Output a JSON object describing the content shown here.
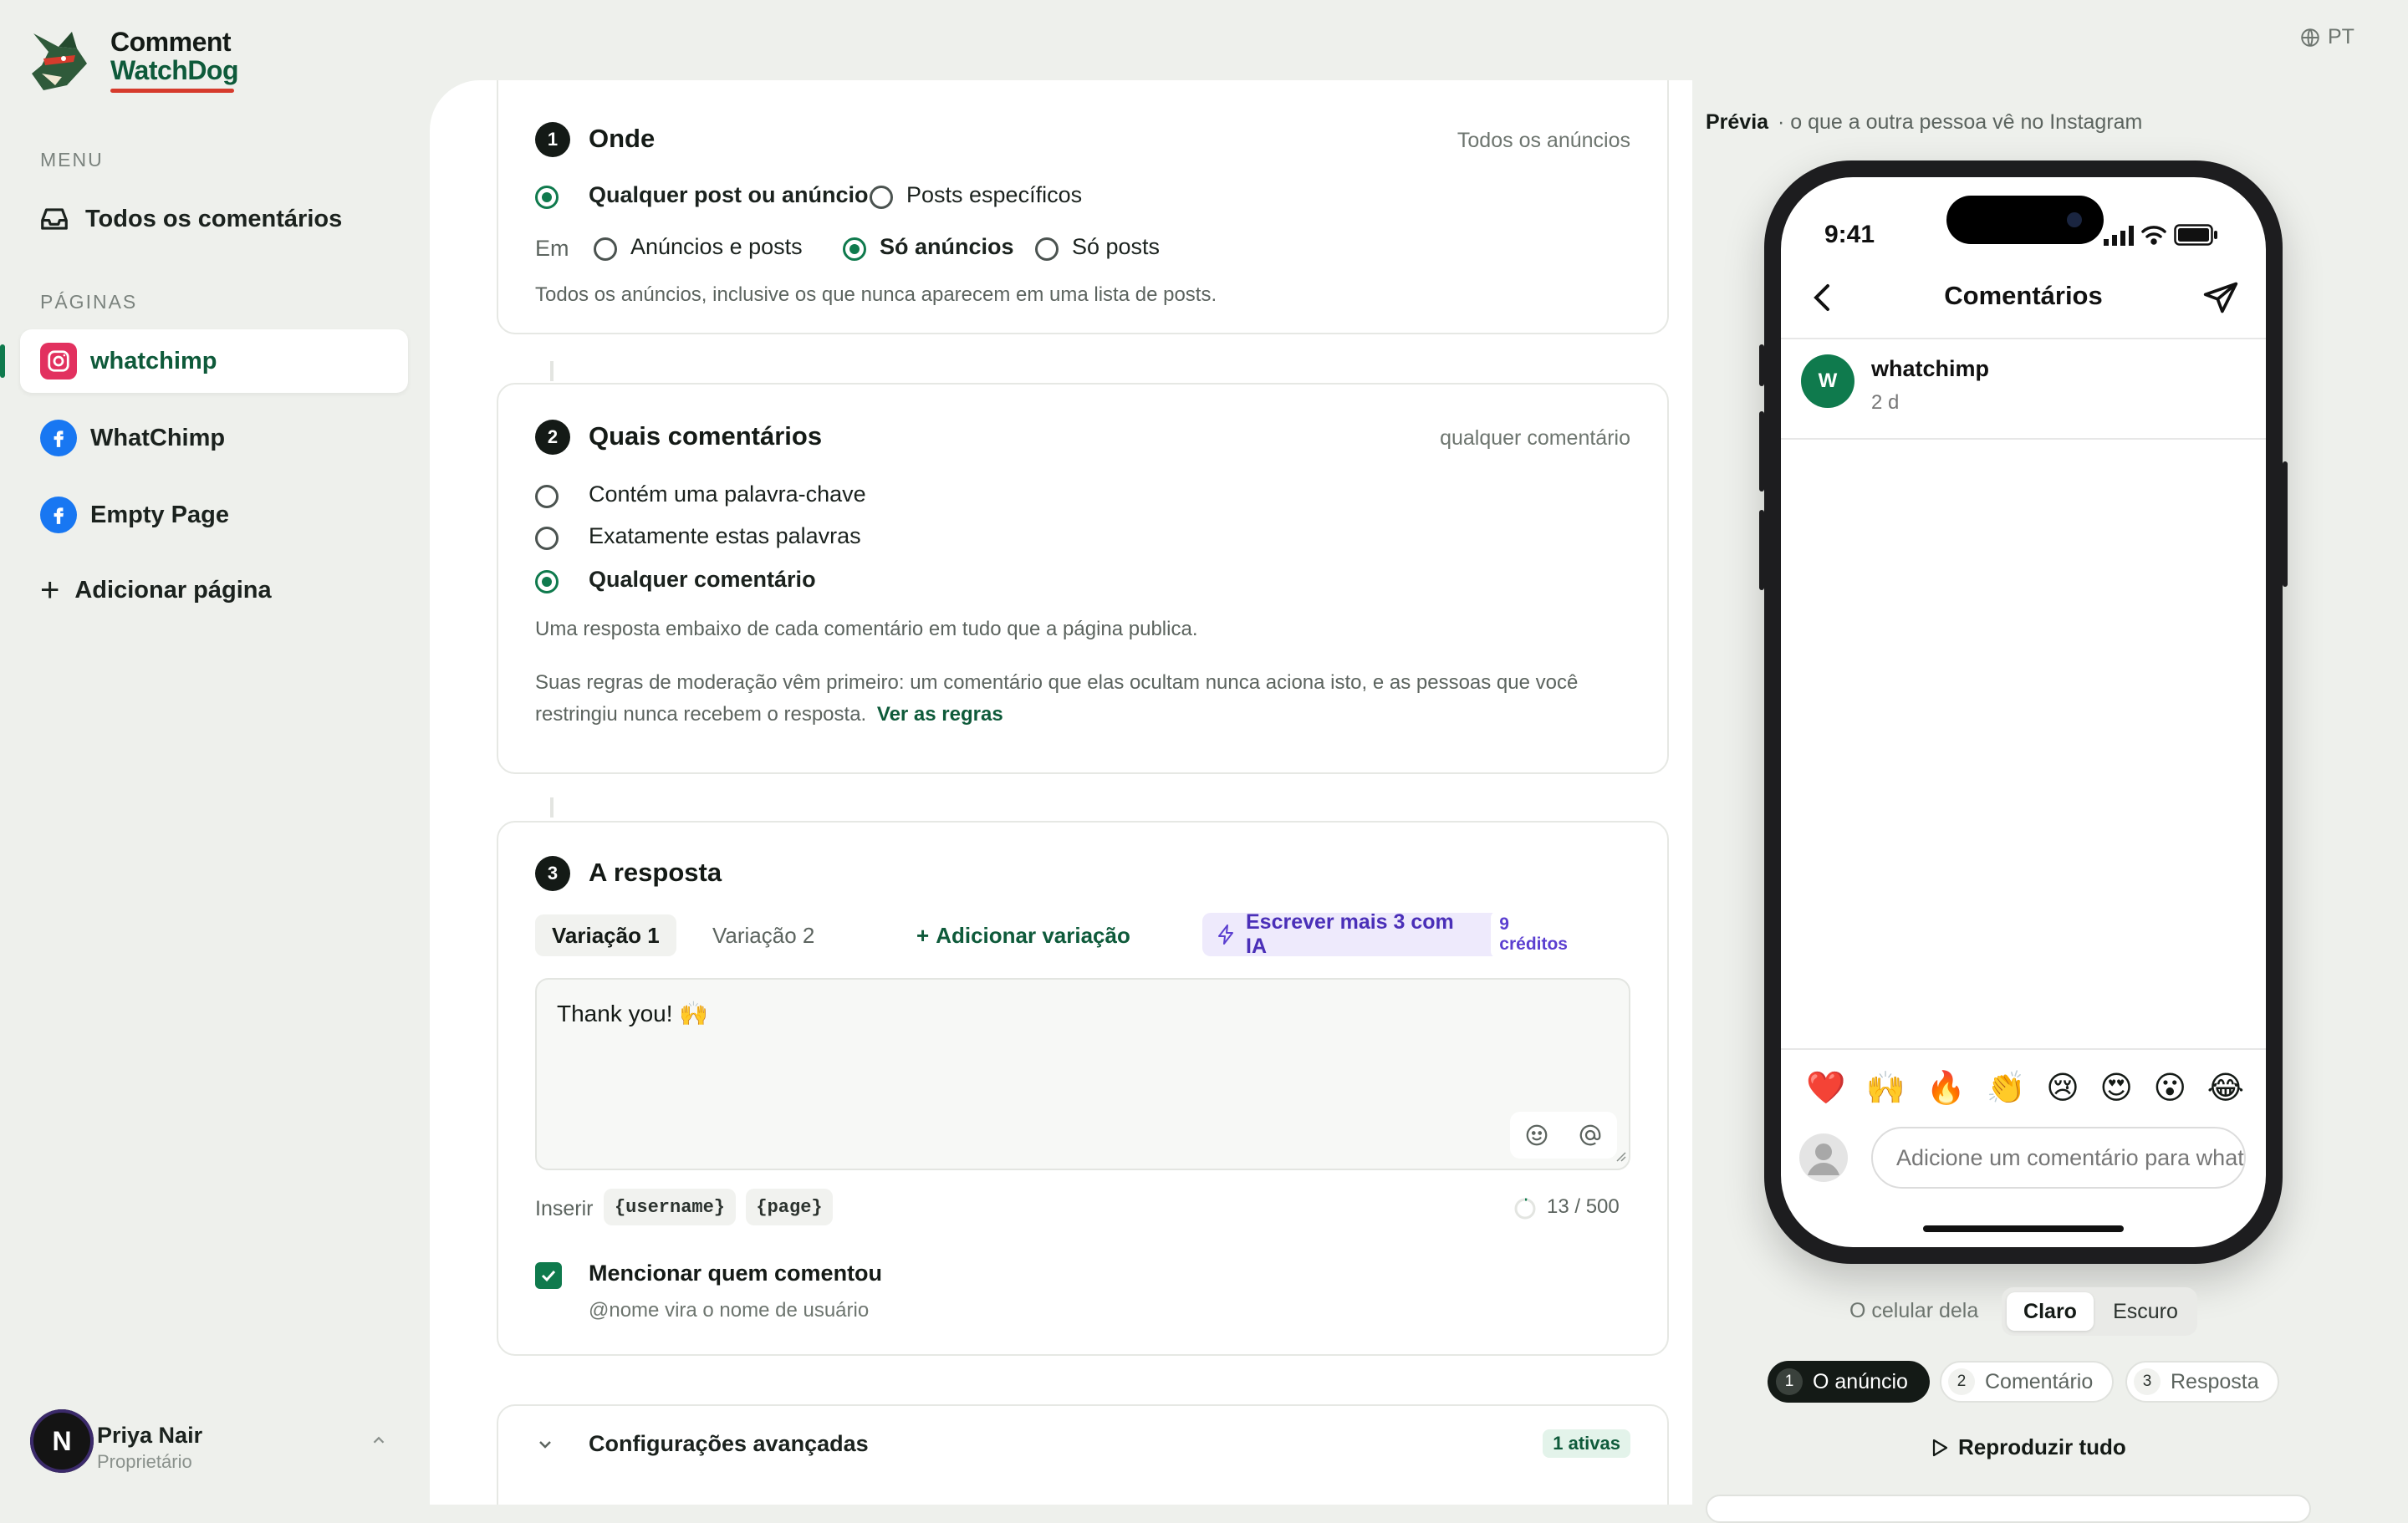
{
  "app": {
    "brand_line1": "Comment",
    "brand_line2": "WatchDog",
    "language": "PT"
  },
  "sidebar": {
    "menu_label": "MENU",
    "menu_item": "Todos os comentários",
    "pages_label": "PÁGINAS",
    "pages": [
      {
        "label": "whatchimp",
        "type": "instagram",
        "active": true
      },
      {
        "label": "WhatChimp",
        "type": "facebook",
        "active": false
      },
      {
        "label": "Empty Page",
        "type": "facebook",
        "active": false
      }
    ],
    "add_page": "Adicionar página",
    "user": {
      "initial": "N",
      "name": "Priya Nair",
      "role": "Proprietário"
    }
  },
  "step1": {
    "number": "1",
    "title": "Onde",
    "hint": "Todos os anúncios",
    "scope_options": [
      "Qualquer post ou anúncio",
      "Posts específicos"
    ],
    "scope_selected": 0,
    "in_label": "Em",
    "in_options": [
      "Anúncios e posts",
      "Só anúncios",
      "Só posts"
    ],
    "in_selected": 1,
    "help": "Todos os anúncios, inclusive os que nunca aparecem em uma lista de posts."
  },
  "step2": {
    "number": "2",
    "title": "Quais comentários",
    "hint": "qualquer comentário",
    "options": [
      "Contém uma palavra-chave",
      "Exatamente estas palavras",
      "Qualquer comentário"
    ],
    "selected": 2,
    "help1": "Uma resposta embaixo de cada comentário em tudo que a página publica.",
    "help2_line1": "Suas regras de moderação vêm primeiro: um comentário que elas ocultam nunca aciona isto, e as pessoas que você",
    "help2_line2": "restringiu nunca recebem o resposta.",
    "rules_link": "Ver as regras"
  },
  "step3": {
    "number": "3",
    "title": "A resposta",
    "variations": [
      "Variação 1",
      "Variação 2"
    ],
    "add_variation": "Adicionar variação",
    "ai_button": "Escrever mais 3 com IA",
    "ai_credits": "9 créditos",
    "reply_text": "Thank you! 🙌",
    "insert_label": "Inserir",
    "tokens": [
      "{username}",
      "{page}"
    ],
    "char_count": "13 / 500",
    "mention_label": "Mencionar quem comentou",
    "mention_checked": true,
    "mention_help": "@nome vira o nome de usuário"
  },
  "advanced": {
    "label": "Configurações avançadas",
    "badge": "1 ativas"
  },
  "preview": {
    "title": "Prévia",
    "subtitle": "· o que a outra pessoa vê no Instagram",
    "phone": {
      "time": "9:41",
      "header": "Comentários",
      "comment_user": "whatchimp",
      "avatar_letter": "W",
      "comment_age": "2 d",
      "emojis": [
        "❤️",
        "🙌",
        "🔥",
        "👏",
        "😢",
        "😍",
        "😮",
        "😂"
      ],
      "input_placeholder": "Adicione um comentário para whatchimp..."
    },
    "theme_label": "O celular dela",
    "themes": [
      "Claro",
      "Escuro"
    ],
    "theme_selected": 0,
    "steps": [
      {
        "n": "1",
        "label": "O anúncio",
        "active": true
      },
      {
        "n": "2",
        "label": "Comentário",
        "active": false
      },
      {
        "n": "3",
        "label": "Resposta",
        "active": false
      }
    ],
    "play_all": "Reproduzir tudo"
  },
  "colors": {
    "accent": "#0f7a4d",
    "brand_red": "#d63b2c",
    "ai_purple": "#5b3fd0",
    "dark": "#141a16"
  }
}
